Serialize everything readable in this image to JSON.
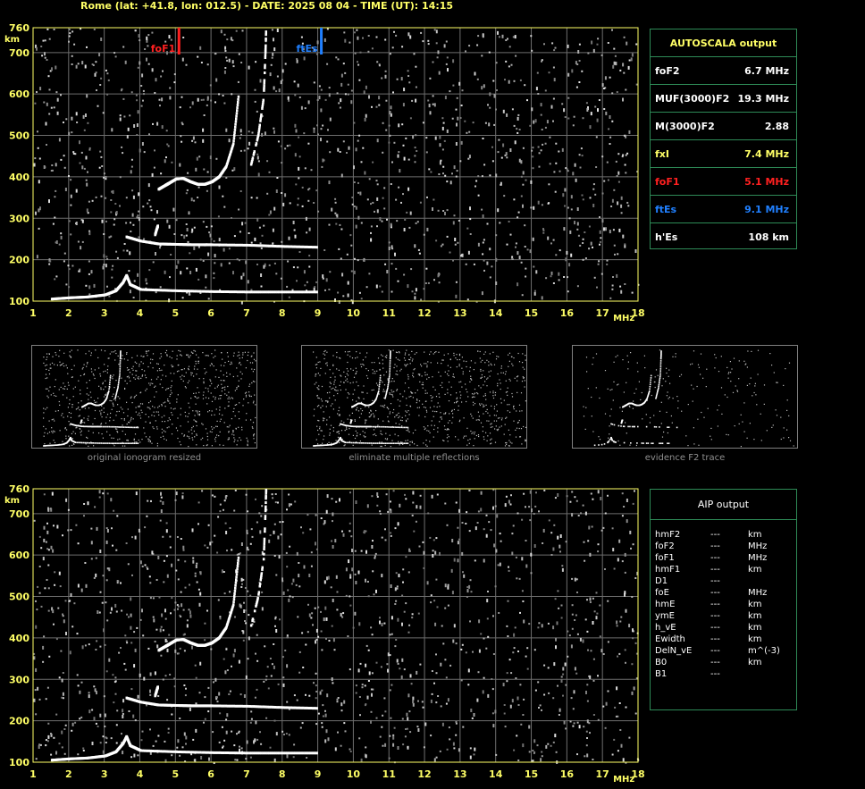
{
  "header": "Rome (lat: +41.8, lon: 012.5) - DATE: 2025 08 04 - TIME (UT): 14:15",
  "colors": {
    "axis": "#ffff66",
    "grid": "#6e6e6e",
    "trace": "#ffffff",
    "foF1_marker": "#ff2020",
    "ftEs_marker": "#2080ff",
    "panel_border": "#2e8b57"
  },
  "chart_data": [
    {
      "type": "scatter",
      "name": "main-ionogram",
      "xlabel": "MHz",
      "ylabel": "km",
      "xlim": [
        1,
        18
      ],
      "ylim": [
        100,
        760
      ],
      "xticks": [
        "1",
        "2",
        "3",
        "4",
        "5",
        "6",
        "7",
        "8",
        "9",
        "10",
        "11",
        "12",
        "13",
        "14",
        "15",
        "16",
        "17",
        "18"
      ],
      "yticks": [
        "100",
        "200",
        "300",
        "400",
        "500",
        "600",
        "700",
        "760"
      ],
      "grid": true,
      "markers": [
        {
          "label": "foF1",
          "x": 5.1,
          "color": "#ff2020"
        },
        {
          "label": "ftEs",
          "x": 9.1,
          "color": "#2080ff"
        }
      ],
      "traces": [
        {
          "name": "E",
          "points": [
            [
              1.5,
              105
            ],
            [
              2.0,
              108
            ],
            [
              2.5,
              110
            ],
            [
              3.0,
              115
            ],
            [
              3.3,
              125
            ],
            [
              3.5,
              145
            ],
            [
              3.6,
              162
            ],
            [
              3.7,
              140
            ],
            [
              4.0,
              128
            ],
            [
              5.0,
              125
            ],
            [
              6.0,
              123
            ],
            [
              7.0,
              122
            ],
            [
              8.0,
              122
            ],
            [
              9.0,
              122
            ]
          ]
        },
        {
          "name": "Es2",
          "points": [
            [
              3.6,
              255
            ],
            [
              4.0,
              245
            ],
            [
              4.5,
              238
            ],
            [
              5.0,
              237
            ],
            [
              5.5,
              236
            ],
            [
              6.0,
              236
            ],
            [
              7.0,
              235
            ],
            [
              8.0,
              232
            ],
            [
              9.0,
              230
            ]
          ]
        },
        {
          "name": "F1",
          "points": [
            [
              4.5,
              370
            ],
            [
              4.7,
              380
            ],
            [
              4.8,
              385
            ],
            [
              5.0,
              395
            ],
            [
              5.2,
              396
            ],
            [
              5.4,
              388
            ],
            [
              5.6,
              382
            ],
            [
              5.8,
              382
            ],
            [
              6.0,
              388
            ],
            [
              6.2,
              400
            ],
            [
              6.4,
              425
            ],
            [
              6.6,
              480
            ],
            [
              6.75,
              600
            ]
          ]
        },
        {
          "name": "F2x",
          "points": [
            [
              7.1,
              430
            ],
            [
              7.3,
              500
            ],
            [
              7.45,
              590
            ],
            [
              7.5,
              700
            ],
            [
              7.52,
              760
            ]
          ]
        },
        {
          "name": "spur",
          "points": [
            [
              4.4,
              260
            ],
            [
              4.45,
              275
            ],
            [
              4.48,
              282
            ]
          ]
        }
      ]
    },
    {
      "type": "scatter",
      "name": "aip-ionogram",
      "xlabel": "MHz",
      "ylabel": "km",
      "xlim": [
        1,
        18
      ],
      "ylim": [
        100,
        760
      ],
      "xticks": [
        "1",
        "2",
        "3",
        "4",
        "5",
        "6",
        "7",
        "8",
        "9",
        "10",
        "11",
        "12",
        "13",
        "14",
        "15",
        "16",
        "17",
        "18"
      ],
      "yticks": [
        "100",
        "200",
        "300",
        "400",
        "500",
        "600",
        "700",
        "760"
      ],
      "grid": true
    }
  ],
  "autoscala": {
    "title": "AUTOSCALA output",
    "rows": [
      {
        "key": "foF2",
        "value": "6.7 MHz",
        "color": "#ffffff"
      },
      {
        "key": "MUF(3000)F2",
        "value": "19.3 MHz",
        "color": "#ffffff"
      },
      {
        "key": "M(3000)F2",
        "value": "2.88",
        "color": "#ffffff"
      },
      {
        "key": "fxI",
        "value": "7.4 MHz",
        "color": "#ffff66"
      },
      {
        "key": "foF1",
        "value": "5.1 MHz",
        "color": "#ff2020"
      },
      {
        "key": "ftEs",
        "value": "9.1 MHz",
        "color": "#2080ff"
      },
      {
        "key": "h'Es",
        "value": "108    km",
        "color": "#ffffff"
      }
    ]
  },
  "thumbnails": [
    {
      "label": "original ionogram resized"
    },
    {
      "label": "eliminate multiple reflections"
    },
    {
      "label": "evidence F2 trace"
    }
  ],
  "aip": {
    "title": "AIP output",
    "rows": [
      {
        "p": "hmF2",
        "v": "---",
        "u": "km"
      },
      {
        "p": "foF2",
        "v": "---",
        "u": "MHz"
      },
      {
        "p": "foF1",
        "v": "---",
        "u": "MHz"
      },
      {
        "p": "hmF1",
        "v": "---",
        "u": "km"
      },
      {
        "p": "D1",
        "v": "---",
        "u": ""
      },
      {
        "p": "foE",
        "v": "---",
        "u": "MHz"
      },
      {
        "p": "hmE",
        "v": "---",
        "u": "km"
      },
      {
        "p": "ymE",
        "v": "---",
        "u": "km"
      },
      {
        "p": "h_vE",
        "v": "---",
        "u": "km"
      },
      {
        "p": "Ewidth",
        "v": "---",
        "u": "km"
      },
      {
        "p": "DelN_vE",
        "v": "---",
        "u": "m^(-3)"
      },
      {
        "p": "B0",
        "v": "---",
        "u": "km"
      },
      {
        "p": "B1",
        "v": "---",
        "u": ""
      }
    ]
  }
}
